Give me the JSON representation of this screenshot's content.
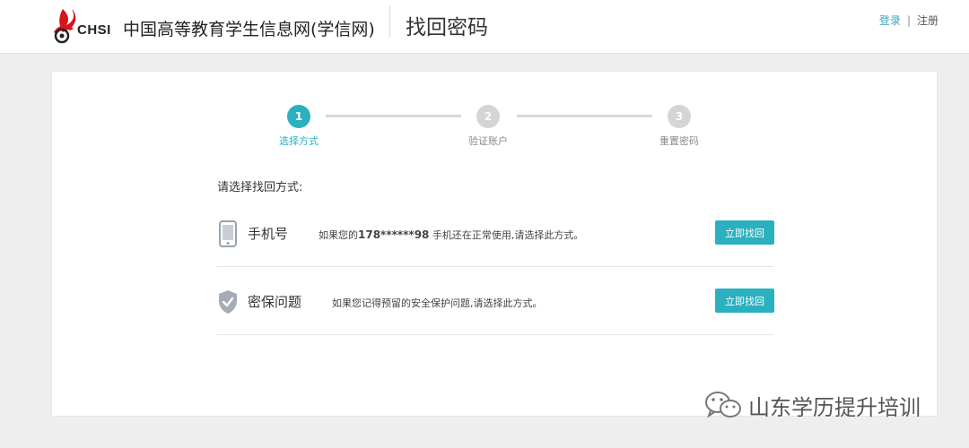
{
  "header": {
    "logo_text": "CHSI",
    "site_name": "中国高等教育学生信息网(学信网)",
    "page_title": "找回密码",
    "login_link": "登录",
    "separator": "|",
    "register_link": "注册"
  },
  "steps": [
    {
      "number": "1",
      "label": "选择方式",
      "state": "active"
    },
    {
      "number": "2",
      "label": "验证账户",
      "state": "inactive"
    },
    {
      "number": "3",
      "label": "重置密码",
      "state": "inactive"
    }
  ],
  "prompt": "请选择找回方式:",
  "options": [
    {
      "icon": "phone-icon",
      "title": "手机号",
      "desc_prefix": "如果您的",
      "desc_masked": "178******98",
      "desc_suffix": " 手机还在正常使用,请选择此方式。",
      "button": "立即找回"
    },
    {
      "icon": "shield-check-icon",
      "title": "密保问题",
      "desc": "如果您记得预留的安全保护问题,请选择此方式。",
      "button": "立即找回"
    }
  ],
  "watermark": {
    "icon": "wechat-icon",
    "text": "山东学历提升培训"
  },
  "colors": {
    "accent": "#2bb0bf",
    "link": "#3aa3b9",
    "inactive": "#d5d5d5",
    "logo_red": "#d7141a"
  }
}
